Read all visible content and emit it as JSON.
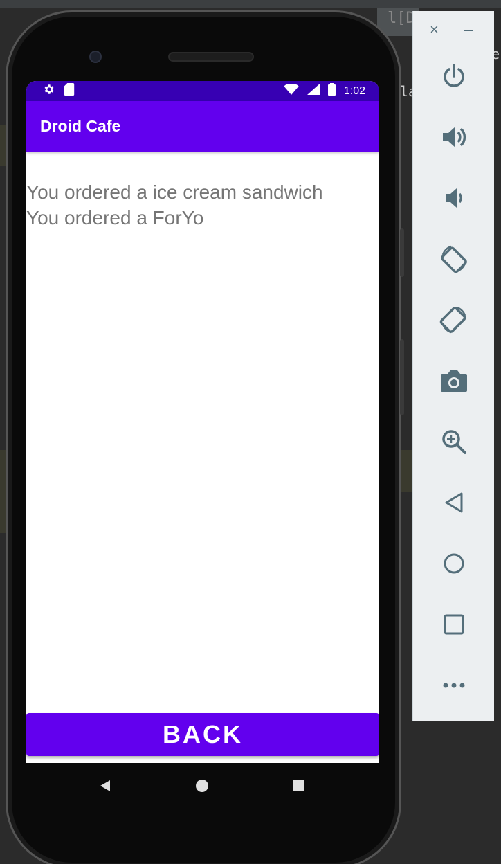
{
  "ide": {
    "fragments": [
      "l[Dr",
      "la",
      "e"
    ]
  },
  "status_bar": {
    "time": "1:02",
    "left_icons": [
      "settings-icon",
      "sd-card-icon"
    ],
    "right_icons": [
      "wifi-icon",
      "signal-icon",
      "battery-icon"
    ]
  },
  "app_bar": {
    "title": "Droid Cafe"
  },
  "content": {
    "lines": [
      "You ordered a ice cream sandwich",
      "You ordered a ForYo"
    ]
  },
  "back_button": {
    "label": "BACK"
  },
  "nav": {
    "items": [
      "back-triangle-icon",
      "home-circle-icon",
      "recents-square-icon"
    ]
  },
  "side_panel": {
    "close_label": "×",
    "minimize_label": "–",
    "buttons": [
      "power-icon",
      "volume-up-icon",
      "volume-down-icon",
      "rotate-left-icon",
      "rotate-right-icon",
      "camera-icon",
      "zoom-icon",
      "back-icon",
      "home-icon",
      "overview-icon",
      "more-icon"
    ]
  },
  "colors": {
    "primary": "#6200ee",
    "primary_dark": "#3700b3",
    "panel_icon": "#546e7a"
  }
}
